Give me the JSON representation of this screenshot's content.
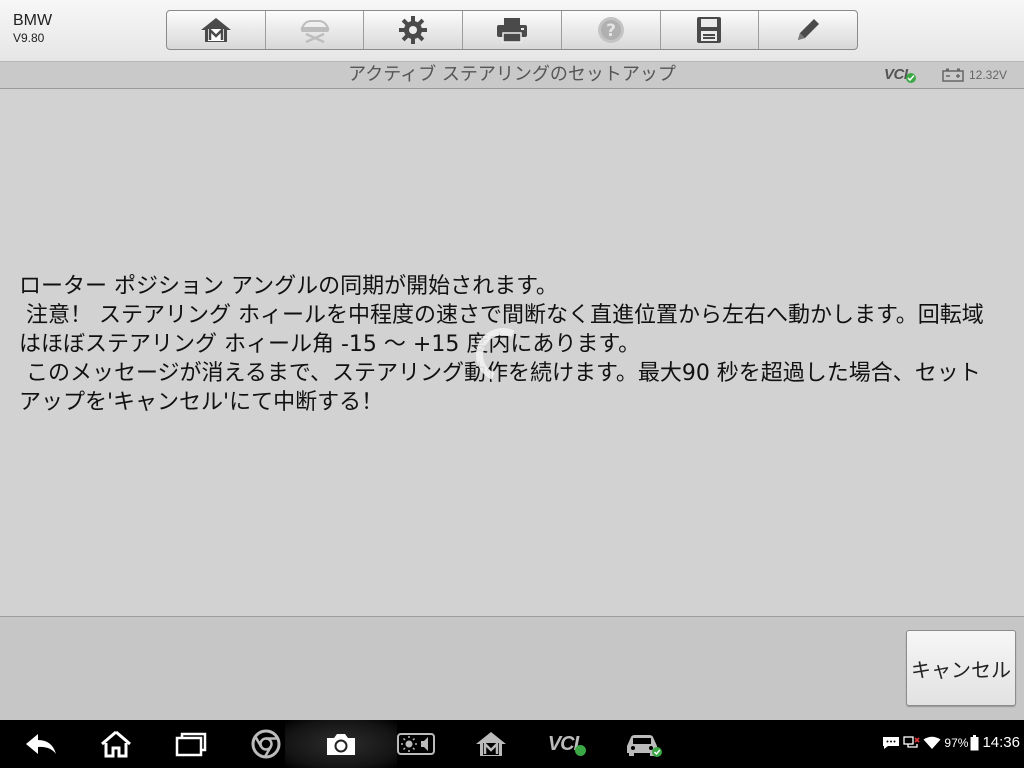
{
  "app": {
    "name": "BMW",
    "version": "V9.80"
  },
  "toolbar": {
    "items": [
      {
        "icon": "home-m-icon",
        "enabled": true
      },
      {
        "icon": "vehicle-lift-icon",
        "enabled": false
      },
      {
        "icon": "gear-icon",
        "enabled": true
      },
      {
        "icon": "printer-icon",
        "enabled": true
      },
      {
        "icon": "help-icon",
        "enabled": false
      },
      {
        "icon": "save-icon",
        "enabled": true
      },
      {
        "icon": "pencil-icon",
        "enabled": true
      }
    ]
  },
  "header": {
    "title": "アクティブ ステアリングのセットアップ",
    "vci_label": "VCI",
    "voltage": "12.32V"
  },
  "message": {
    "text": "ローター ポジション アングルの同期が開始されます。\n 注意！ ステアリング ホィールを中程度の速さで間断なく直進位置から左右へ動かします。回転域はほぼステアリング ホィール角 -15 ～ +15 度内にあります。\n このメッセージが消えるまで、ステアリング動作を続けます。最大90 秒を超過した場合、セットアップを'キャンセル'にて中断する！"
  },
  "actions": {
    "cancel_label": "キャンセル"
  },
  "system_bar": {
    "vci_label": "VCI",
    "battery_percent": "97%",
    "time": "14:36"
  },
  "colors": {
    "content_bg": "#d2d2d2",
    "action_bg": "#c6c6c6",
    "check_green": "#3aa844",
    "nav_bg": "#000000"
  }
}
